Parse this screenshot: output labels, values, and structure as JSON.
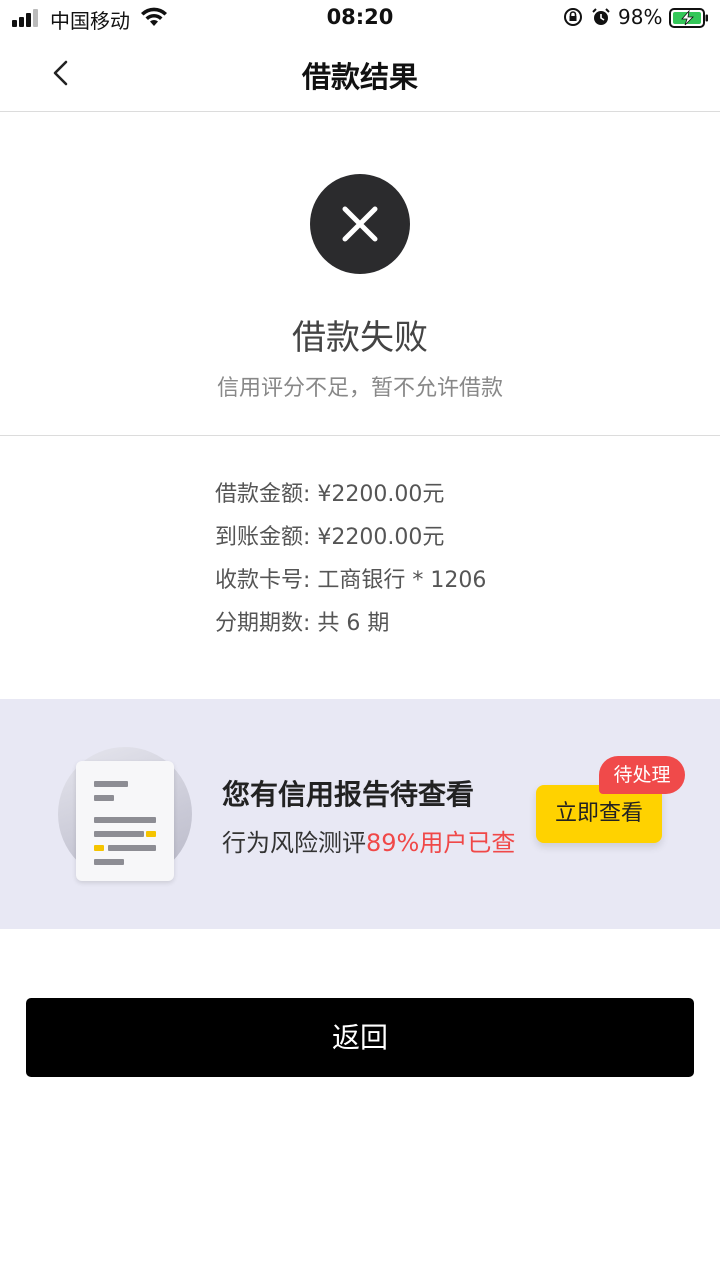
{
  "status_bar": {
    "carrier": "中国移动",
    "time": "08:20",
    "battery": "98%",
    "icons": [
      "signal-icon",
      "wifi-icon",
      "rotation-lock-icon",
      "alarm-icon",
      "battery-charging-icon"
    ]
  },
  "nav": {
    "title": "借款结果",
    "back_icon": "chevron-left-icon"
  },
  "result": {
    "icon": "close-icon",
    "title": "借款失败",
    "subtitle": "信用评分不足，暂不允许借款"
  },
  "details": [
    {
      "text": "借款金额: ¥2200.00元"
    },
    {
      "text": "到账金额: ¥2200.00元"
    },
    {
      "text": "收款卡号: 工商银行 * 1206"
    },
    {
      "text": "分期期数: 共 6 期"
    }
  ],
  "banner": {
    "title": "您有信用报告待查看",
    "sub_prefix": "行为风险测评",
    "sub_highlight": "89%用户已查",
    "button_label": "立即查看",
    "badge": "待处理",
    "colors": {
      "background": "#e8e8f4",
      "button": "#ffd200",
      "badge": "#f04a4a",
      "highlight": "#f04848"
    }
  },
  "return_button": "返回"
}
